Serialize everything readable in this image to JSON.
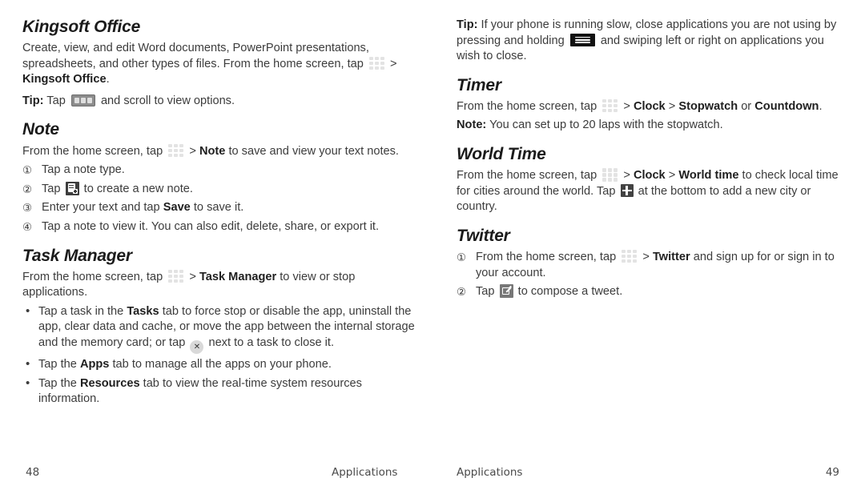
{
  "document": {
    "type": "phone-user-manual-spread",
    "left_page_number": "48",
    "right_page_number": "49",
    "running_footer_left": "Applications",
    "running_footer_right": "Applications"
  },
  "icons": {
    "apps_grid": "apps-grid-icon",
    "options_bar": "options-bar-icon",
    "new_note": "new-note-icon",
    "close": "close-icon",
    "menu_key": "menu-key-icon",
    "plus": "plus-icon",
    "compose": "compose-tweet-icon",
    "close_glyph": "✕"
  },
  "left_column": {
    "kingsoft": {
      "heading": "Kingsoft Office",
      "p1_a": "Create, view, and edit Word documents, PowerPoint presentations, spreadsheets, and other types of files. From the home screen, tap",
      "p1_sep": ">",
      "p1_b": "Kingsoft Office",
      "p1_c": ".",
      "tip_label": "Tip:",
      "tip_a": "Tap",
      "tip_b": "and scroll to view options."
    },
    "note": {
      "heading": "Note",
      "p1_a": "From the home screen, tap",
      "p1_sep": ">",
      "p1_b": "Note",
      "p1_c": "to save and view your text notes.",
      "steps": [
        {
          "marker": "①",
          "a": "Tap a note type.",
          "b": "",
          "c": ""
        },
        {
          "marker": "②",
          "a": "Tap",
          "b": "",
          "c": "to create a new note."
        },
        {
          "marker": "③",
          "a": "Enter your text and tap",
          "b": "Save",
          "c": "to save it."
        },
        {
          "marker": "④",
          "a": "Tap a note to view it. You can also edit, delete, share, or export it.",
          "b": "",
          "c": ""
        }
      ]
    },
    "task_manager": {
      "heading": "Task Manager",
      "p1_a": "From the home screen, tap",
      "p1_sep": ">",
      "p1_b": "Task Manager",
      "p1_c": "to view or stop applications.",
      "bullets": [
        {
          "marker": "•",
          "a": "Tap a task in the",
          "b": "Tasks",
          "c": "tab to force stop or disable the app, uninstall the app, clear data and cache, or move the app between the internal storage and the memory card; or tap",
          "d": "next to a task to close it."
        },
        {
          "marker": "•",
          "a": "Tap the",
          "b": "Apps",
          "c": "tab to manage all the apps on your phone.",
          "d": ""
        },
        {
          "marker": "•",
          "a": "Tap the",
          "b": "Resources",
          "c": "tab to view the real-time system resources information.",
          "d": ""
        }
      ]
    }
  },
  "right_column": {
    "tip": {
      "label": "Tip:",
      "a": "If your phone is running slow, close applications you are not using by pressing and holding",
      "b": "and swiping left or right on applications you wish to close."
    },
    "timer": {
      "heading": "Timer",
      "p1_a": "From the home screen, tap",
      "p1_sep1": ">",
      "p1_b": "Clock",
      "p1_sep2": ">",
      "p1_c": "Stopwatch",
      "p1_d": "or",
      "p1_e": "Countdown",
      "p1_f": ".",
      "note_label": "Note:",
      "note_text": "You can set up to 20 laps with the stopwatch."
    },
    "world_time": {
      "heading": "World Time",
      "p1_a": "From the home screen, tap",
      "p1_sep1": ">",
      "p1_b": "Clock",
      "p1_sep2": ">",
      "p1_c": "World time",
      "p1_d": "to check local time for cities around the world. Tap",
      "p1_e": "at the bottom to add a new city or country."
    },
    "twitter": {
      "heading": "Twitter",
      "steps": [
        {
          "marker": "①",
          "a": "From the home screen, tap",
          "sep": ">",
          "b": "Twitter",
          "c": "and sign up for or sign in to your account."
        },
        {
          "marker": "②",
          "a": "Tap",
          "sep": "",
          "b": "",
          "c": "to compose a tweet."
        }
      ]
    }
  }
}
